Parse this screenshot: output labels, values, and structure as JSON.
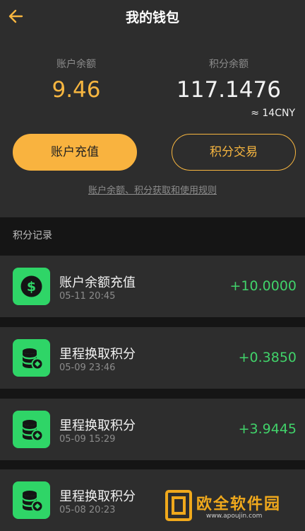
{
  "header": {
    "title": "我的钱包",
    "back_icon": "arrow-left-icon"
  },
  "balances": {
    "account_label": "账户余额",
    "account_value": "9.46",
    "points_label": "积分余额",
    "points_value": "117.1476",
    "points_approx": "≈ 14CNY"
  },
  "actions": {
    "recharge_label": "账户充值",
    "trade_label": "积分交易"
  },
  "rules_link": "账户余额、积分获取和使用规则",
  "records": {
    "section_label": "积分记录",
    "items": [
      {
        "title": "账户余额充值",
        "time": "05-11 20:45",
        "amount": "+10.0000",
        "icon": "dollar-icon"
      },
      {
        "title": "里程换取积分",
        "time": "05-09 23:46",
        "amount": "+0.3850",
        "icon": "coin-stack-icon"
      },
      {
        "title": "里程换取积分",
        "time": "05-09 15:29",
        "amount": "+3.9445",
        "icon": "coin-stack-icon"
      },
      {
        "title": "里程换取积分",
        "time": "05-08 20:23",
        "amount": "",
        "icon": "coin-stack-icon"
      }
    ]
  },
  "watermark": {
    "text": "欧全软件园",
    "url": "www.apoujin.com"
  },
  "colors": {
    "accent": "#f7b640",
    "positive": "#41d36a",
    "icon_bg": "#2fd567",
    "card_bg": "#2d2d2d",
    "page_bg": "#151515"
  }
}
